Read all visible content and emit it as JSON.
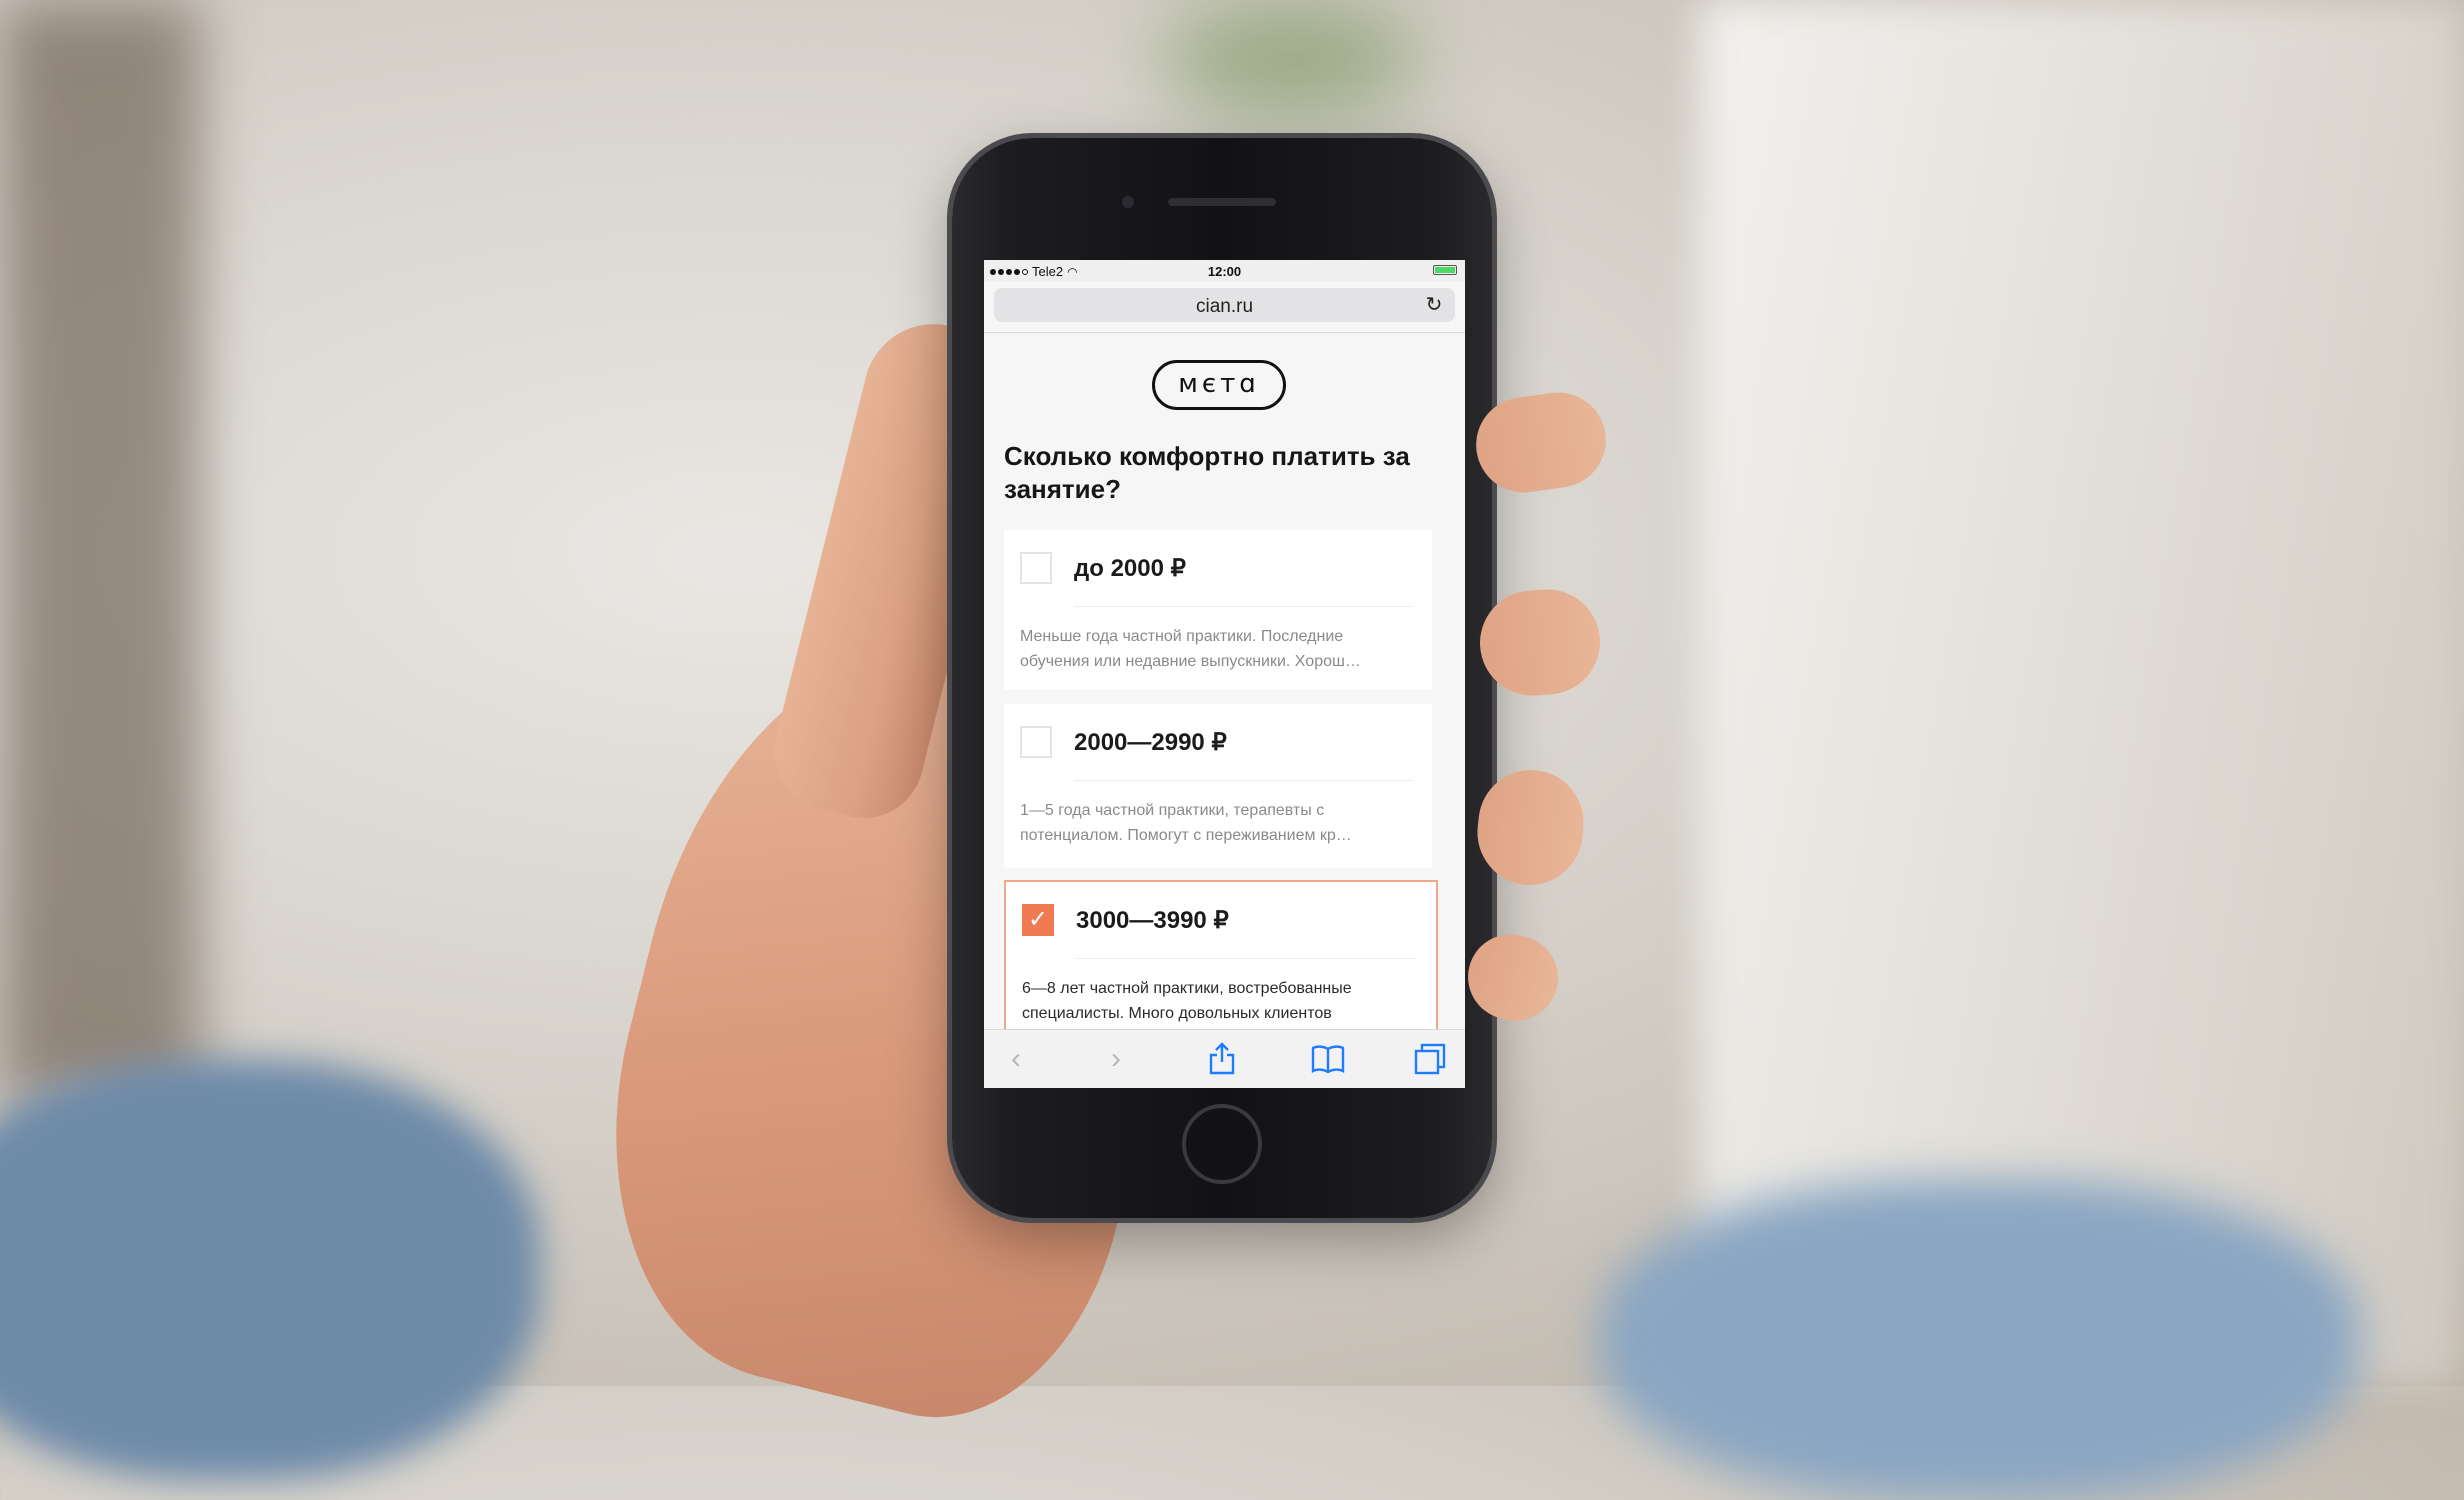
{
  "status_bar": {
    "carrier": "Tele2",
    "time": "12:00"
  },
  "browser": {
    "url": "cian.ru"
  },
  "page": {
    "logo_text": "мєтɑ",
    "question": "Сколько комфортно платить за занятие?",
    "options": [
      {
        "label": "до 2000 ₽",
        "description": "Меньше года частной практики. Последние обучения или недавние выпускники. Хорош…",
        "checked": false
      },
      {
        "label": "2000—2990 ₽",
        "description": "1—5 года частной практики, терапевты с потенциалом. Помогут с переживанием кр…",
        "checked": false
      },
      {
        "label": "3000—3990 ₽",
        "description": "6—8 лет частной практики, востребованные специалисты. Много довольных клиентов",
        "checked": true
      }
    ],
    "accent_color": "#f07a52"
  },
  "toolbar": {
    "icons": [
      "back-icon",
      "forward-icon",
      "share-icon",
      "bookmarks-icon",
      "tabs-icon"
    ]
  }
}
